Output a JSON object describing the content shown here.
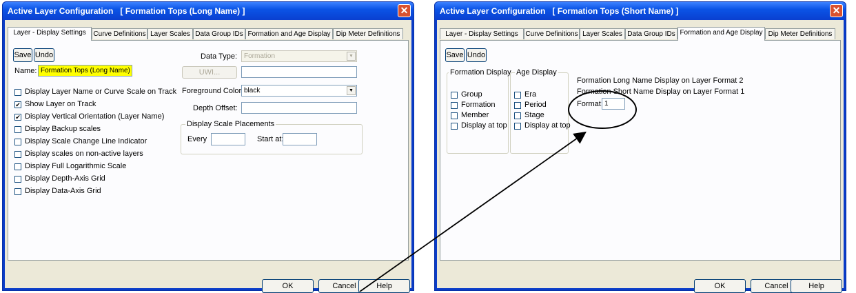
{
  "dialog1": {
    "title": "Active Layer Configuration   [ Formation Tops (Long Name) ]",
    "tabs": [
      "Layer - Display Settings",
      "Curve Definitions",
      "Layer Scales",
      "Data Group IDs",
      "Formation and Age Display",
      "Dip Meter Definitions"
    ],
    "active_tab": "Layer - Display Settings",
    "save_label": "Save",
    "undo_label": "Undo",
    "name_label": "Name:",
    "name_value": "Formation Tops (Long Name)",
    "checkboxes": [
      {
        "label": "Display Layer Name or Curve Scale on Track",
        "checked": false
      },
      {
        "label": "Show Layer on Track",
        "checked": true
      },
      {
        "label": "Display Vertical Orientation (Layer Name)",
        "checked": true
      },
      {
        "label": "Display Backup scales",
        "checked": false
      },
      {
        "label": "Display Scale Change Line Indicator",
        "checked": false
      },
      {
        "label": "Display scales on non-active layers",
        "checked": false
      },
      {
        "label": "Display Full Logarithmic Scale",
        "checked": false
      },
      {
        "label": "Display Depth-Axis Grid",
        "checked": false
      },
      {
        "label": "Display Data-Axis Grid",
        "checked": false
      }
    ],
    "data_type_label": "Data Type:",
    "data_type_value": "Formation",
    "uwi_button": "UWI...",
    "uwi_value": "",
    "fg_color_label": "Foreground Color:",
    "fg_color_value": "black",
    "depth_offset_label": "Depth Offset:",
    "depth_offset_value": "",
    "scale_group_title": "Display Scale Placements",
    "every_label": "Every",
    "every_value": "",
    "start_at_label": "Start at:",
    "start_at_value": "",
    "ok_label": "OK",
    "cancel_label": "Cancel",
    "help_label": "Help"
  },
  "dialog2": {
    "title": "Active Layer Configuration   [ Formation Tops (Short Name) ]",
    "tabs": [
      "Layer - Display Settings",
      "Curve Definitions",
      "Layer Scales",
      "Data Group IDs",
      "Formation and Age Display",
      "Dip Meter Definitions"
    ],
    "active_tab": "Formation and Age Display",
    "save_label": "Save",
    "undo_label": "Undo",
    "formation_group_title": "Formation Display",
    "formation_items": [
      "Group",
      "Formation",
      "Member",
      "Display at top"
    ],
    "age_group_title": "Age Display",
    "age_items": [
      "Era",
      "Period",
      "Stage",
      "Display at top"
    ],
    "long_name_text": "Formation Long Name Display on Layer Format 2",
    "short_name_text": "Formation Short Name Display on Layer Format 1",
    "format_label": "Format:",
    "format_value": "1",
    "ok_label": "OK",
    "cancel_label": "Cancel",
    "help_label": "Help"
  },
  "colors": {
    "titlebar": "#0b54e6",
    "dialog_bg": "#ece9d8",
    "highlight_yellow": "#ffff00",
    "close_button": "#d9512f"
  },
  "icons": [
    "close-icon",
    "dropdown-arrow-icon",
    "checkmark-icon"
  ]
}
